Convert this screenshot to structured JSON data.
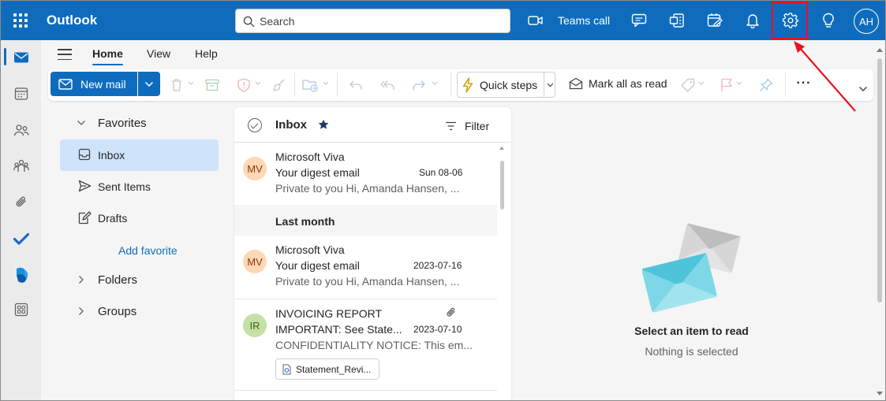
{
  "app": {
    "name": "Outlook",
    "brand_color": "#0f6cbd"
  },
  "search": {
    "placeholder": "Search"
  },
  "topbar": {
    "teams_call_label": "Teams call",
    "icons": [
      "camera-icon",
      "chat-feedback-icon",
      "office-icon",
      "calendar-edit-icon",
      "bell-icon",
      "gear-icon",
      "lightbulb-icon"
    ],
    "avatar_initials": "AH",
    "highlight_color": "#e81123"
  },
  "tabs": [
    {
      "label": "Home",
      "active": true
    },
    {
      "label": "View",
      "active": false
    },
    {
      "label": "Help",
      "active": false
    }
  ],
  "ribbon": {
    "new_mail_label": "New mail",
    "quick_steps_label": "Quick steps",
    "mark_all_read_label": "Mark all as read",
    "more_label": "···"
  },
  "folders": {
    "favorites_label": "Favorites",
    "items": [
      {
        "label": "Inbox",
        "icon": "inbox-icon",
        "active": true
      },
      {
        "label": "Sent Items",
        "icon": "send-icon",
        "active": false
      },
      {
        "label": "Drafts",
        "icon": "drafts-icon",
        "active": false
      }
    ],
    "add_favorite_label": "Add favorite",
    "folders_label": "Folders",
    "groups_label": "Groups"
  },
  "list": {
    "title": "Inbox",
    "filter_label": "Filter",
    "section_last_month": "Last month",
    "messages": [
      {
        "initials": "MV",
        "avatar_bg": "#fdd8b5",
        "avatar_fg": "#8a3707",
        "sender": "Microsoft Viva",
        "subject": "Your digest email",
        "date": "Sun 08-06",
        "preview": "Private to you Hi, Amanda Hansen, ..."
      },
      {
        "initials": "MV",
        "avatar_bg": "#fdd8b5",
        "avatar_fg": "#8a3707",
        "sender": "Microsoft Viva",
        "subject": "Your digest email",
        "date": "2023-07-16",
        "preview": "Private to you Hi, Amanda Hansen, ..."
      },
      {
        "initials": "IR",
        "avatar_bg": "#c5e0a5",
        "avatar_fg": "#405e1f",
        "sender": "INVOICING REPORT",
        "subject": "IMPORTANT: See State...",
        "date": "2023-07-10",
        "preview": "CONFIDENTIALITY NOTICE: This em...",
        "attachment": "Statement_Revi..."
      }
    ]
  },
  "reading": {
    "title": "Select an item to read",
    "subtitle": "Nothing is selected"
  }
}
